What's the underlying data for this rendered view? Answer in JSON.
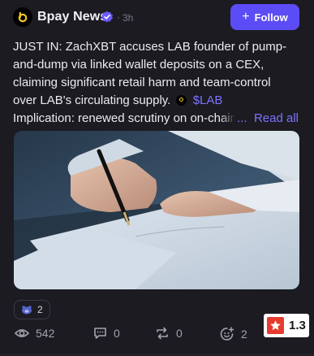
{
  "post": {
    "author": "Bpay News",
    "separator": "·",
    "time": "3h",
    "follow_label": "Follow",
    "text_lines": [
      "JUST IN: ZachXBT accuses LAB founder of pump-",
      "and-dump via linked wallet deposits on a CEX,",
      "claiming significant retail harm and team-control",
      "over LAB's circulating supply."
    ],
    "cashtag": "$LAB",
    "implication": "Implication: renewed scrutiny on on-chain",
    "ellipsis": "...",
    "read_all": "Read all",
    "reaction_count": "2",
    "stats": {
      "views": "542",
      "comments": "0",
      "reposts": "0",
      "likes": "2"
    },
    "rating": "1.3"
  },
  "colors": {
    "background": "#1c1b22",
    "accent": "#5b4cf5",
    "link": "#7d73ff",
    "muted": "#a3a2ad",
    "rating_star": "#e63b2e"
  },
  "icons": [
    "verified-badge-icon",
    "plus-icon",
    "lab-coin-icon",
    "bear-emoji-icon",
    "eye-icon",
    "comment-icon",
    "repost-icon",
    "add-reaction-icon",
    "star-icon"
  ]
}
